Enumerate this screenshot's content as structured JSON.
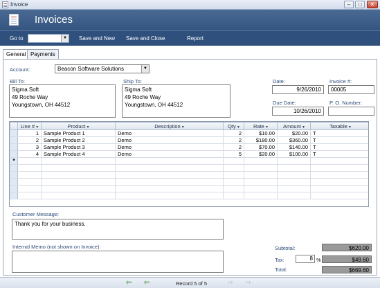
{
  "window": {
    "title": "Invoice",
    "min": "–",
    "max": "□",
    "close": "✕"
  },
  "header": {
    "title": "Invoices"
  },
  "toolbar": {
    "goto_label": "Go to",
    "goto_value": "",
    "save_new": "Save and New",
    "save_close": "Save and Close",
    "report": "Report"
  },
  "tabs": [
    {
      "label": "General",
      "active": true
    },
    {
      "label": "Payments",
      "active": false
    }
  ],
  "account": {
    "label": "Account:",
    "value": "Beacon Software Solutions"
  },
  "bill_to": {
    "label": "Bill To:",
    "lines": [
      "Sigma Soft",
      "49 Roche Way",
      "Youngstown,  OH 44512"
    ]
  },
  "ship_to": {
    "label": "Ship To:",
    "lines": [
      "Sigma Soft",
      "49 Roche Way",
      "Youngstown,  OH 44512"
    ]
  },
  "date": {
    "label": "Date:",
    "value": "9/26/2010"
  },
  "invoice_no": {
    "label": "Invoice #:",
    "value": "00005"
  },
  "due_date": {
    "label": "Due Date:",
    "value": "10/26/2010"
  },
  "po_number": {
    "label": "P. O. Number:",
    "value": ""
  },
  "grid": {
    "columns": [
      "Line #",
      "Product",
      "Description",
      "Qty",
      "Rate",
      "Amount",
      "Taxable"
    ],
    "rows": [
      {
        "line": "1",
        "product": "Sample Product 1",
        "description": "Demo",
        "qty": "2",
        "rate": "$10.00",
        "amount": "$20.00",
        "taxable": "T"
      },
      {
        "line": "2",
        "product": "Sample Product 2",
        "description": "Demo",
        "qty": "2",
        "rate": "$180.00",
        "amount": "$360.00",
        "taxable": "T"
      },
      {
        "line": "3",
        "product": "Sample Product 3",
        "description": "Demo",
        "qty": "2",
        "rate": "$70.00",
        "amount": "$140.00",
        "taxable": "T"
      },
      {
        "line": "4",
        "product": "Sample Product 4",
        "description": "Demo",
        "qty": "5",
        "rate": "$20.00",
        "amount": "$100.00",
        "taxable": "T"
      }
    ],
    "new_row_marker": "*"
  },
  "customer_message": {
    "label": "Customer Message:",
    "value": "Thank you for your business."
  },
  "internal_memo": {
    "label": "Internal Memo (not shown on Invoice):",
    "value": ""
  },
  "totals": {
    "subtotal_label": "Subtotal:",
    "subtotal": "$620.00",
    "tax_label": "Tax:",
    "tax_rate": "8",
    "tax_pct": "%",
    "tax": "$49.60",
    "total_label": "Total:",
    "total": "$669.60"
  },
  "record_nav": {
    "text": "Record 5 of 5"
  },
  "colors": {
    "header": "#3e5f8a",
    "toolbar": "#2f4f7c",
    "label": "#2d4b7a",
    "total_box": "#9a9a9a"
  },
  "icons": [
    "form-icon",
    "dropdown-arrow-icon",
    "first-record-icon",
    "previous-record-icon",
    "next-record-icon",
    "last-record-icon"
  ]
}
